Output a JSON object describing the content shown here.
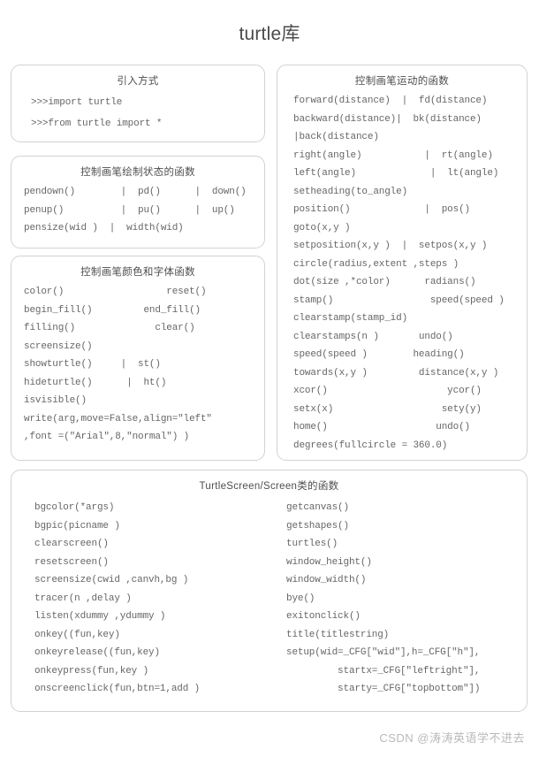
{
  "title": "turtle库",
  "cards": {
    "import": {
      "title": "引入方式",
      "lines": [
        ">>>import turtle",
        ">>>from turtle import *"
      ]
    },
    "pen_state": {
      "title": "控制画笔绘制状态的函数",
      "lines": [
        "pendown()        |  pd()      |  down()",
        "penup()          |  pu()      |  up()",
        "pensize(wid )  |  width(wid)"
      ]
    },
    "pen_color": {
      "title": "控制画笔颜色和字体函数",
      "lines": [
        "color()                  reset()",
        "begin_fill()         end_fill()",
        "filling()              clear()",
        "screensize()",
        "showturtle()     |  st()",
        "hideturtle()      |  ht()",
        "isvisible()",
        "write(arg,move=False,align=\"left\"",
        ",font =(\"Arial\",8,\"normal\") )"
      ]
    },
    "motion": {
      "title": "控制画笔运动的函数",
      "lines": [
        "forward(distance)  |  fd(distance)",
        "backward(distance)|  bk(distance)",
        "|back(distance)",
        "right(angle)           |  rt(angle)",
        "left(angle)             |  lt(angle)",
        "setheading(to_angle)",
        "position()             |  pos()",
        "goto(x,y )",
        "setposition(x,y )  |  setpos(x,y )",
        "circle(radius,extent ,steps )",
        "dot(size ,*color)      radians()",
        "stamp()                 speed(speed )",
        "clearstamp(stamp_id)",
        "clearstamps(n )       undo()",
        "speed(speed )        heading()",
        "towards(x,y )         distance(x,y )",
        "xcor()                     ycor()",
        "setx(x)                   sety(y)",
        "home()                   undo()",
        "degrees(fullcircle = 360.0)"
      ]
    },
    "screen": {
      "title": "TurtleScreen/Screen类的函数",
      "left_lines": [
        "bgcolor(*args)",
        "bgpic(picname )",
        "clearscreen()",
        "resetscreen()",
        "screensize(cwid ,canvh,bg )",
        "tracer(n ,delay )",
        "listen(xdummy ,ydummy )",
        "onkey((fun,key)",
        "onkeyrelease((fun,key)",
        "onkeypress(fun,key )",
        "onscreenclick(fun,btn=1,add )"
      ],
      "right_lines": [
        "getcanvas()",
        "getshapes()",
        "turtles()",
        "window_height()",
        "window_width()",
        "bye()",
        "exitonclick()",
        "title(titlestring)",
        "setup(wid=_CFG[\"wid\"],h=_CFG[\"h\"],",
        "         startx=_CFG[\"leftright\"],",
        "         starty=_CFG[\"topbottom\"])"
      ]
    }
  },
  "watermark": "CSDN @涛涛英语学不进去",
  "colors": {
    "card_border": "#d2d2d2",
    "code_text": "#666666",
    "title_text": "#4a4a4a",
    "watermark_text": "#b9b9b9",
    "background": "#ffffff"
  }
}
